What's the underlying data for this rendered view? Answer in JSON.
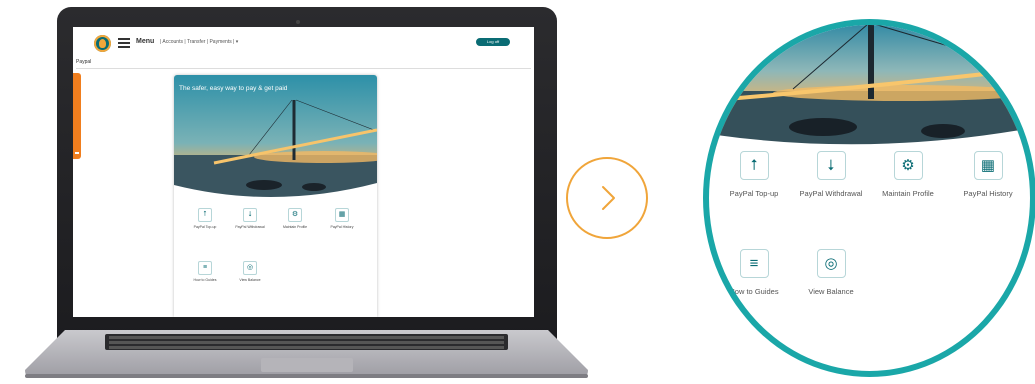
{
  "colors": {
    "brand_teal": "#0a6c74",
    "accent_orange": "#f07e1e",
    "circle_teal": "#1aa7a8",
    "arrow_orange": "#f0a53a"
  },
  "app": {
    "menu_label": "Menu",
    "header_links": "| Accounts | Transfer | Payments | ▾",
    "logoff_label": "Log off",
    "page_heading": "Paypal",
    "hero_title": "The safer, easy way to pay & get paid"
  },
  "tiles": [
    {
      "label": "PayPal Top-up",
      "icon": "topup-icon",
      "glyph": "⭡"
    },
    {
      "label": "PayPal Withdrawal",
      "icon": "withdrawal-icon",
      "glyph": "⭣"
    },
    {
      "label": "Maintain Profile",
      "icon": "profile-icon",
      "glyph": "⚙"
    },
    {
      "label": "PayPal History",
      "icon": "calendar-icon",
      "glyph": "▦"
    },
    {
      "label": "How to Guides",
      "icon": "guide-icon",
      "glyph": "≡"
    },
    {
      "label": "View Balance",
      "icon": "balance-icon",
      "glyph": "◎"
    }
  ]
}
